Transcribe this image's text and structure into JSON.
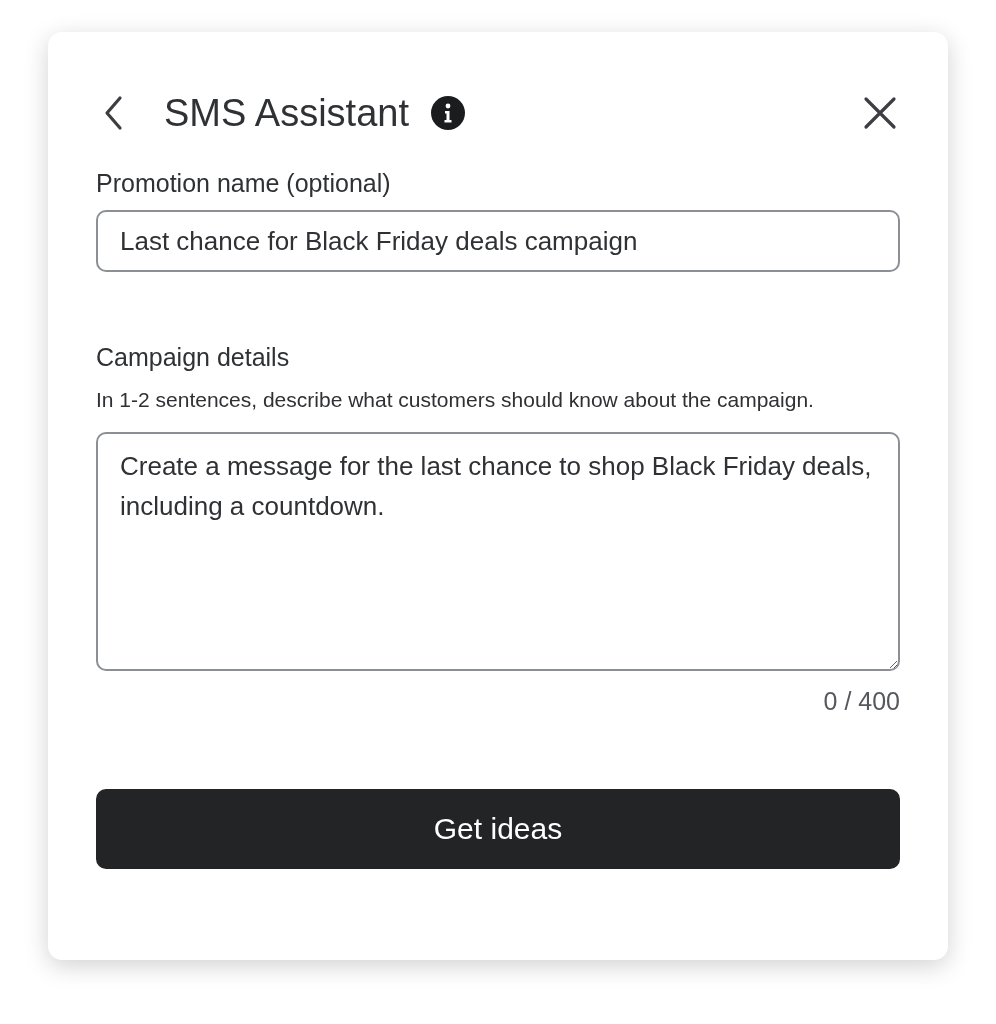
{
  "header": {
    "title": "SMS Assistant"
  },
  "promotion_name": {
    "label": "Promotion name (optional)",
    "value": "Last chance for Black Friday deals campaign"
  },
  "campaign_details": {
    "label": "Campaign details",
    "help": "In 1-2 sentences, describe what customers should know about the campaign.",
    "placeholder": "Create a message for the last chance to shop Black Friday deals, including a countdown.",
    "counter": "0 / 400"
  },
  "submit_button": {
    "label": "Get ideas"
  }
}
